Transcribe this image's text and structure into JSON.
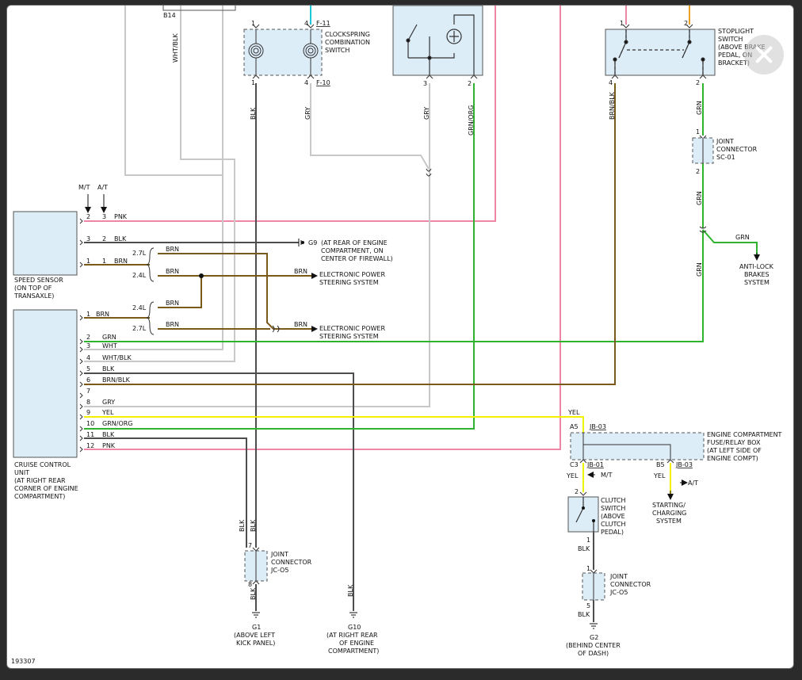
{
  "diagram_id": "193307",
  "colors": {
    "pink": "#ee86a6",
    "black": "#4d4d4d",
    "white": "#c8c8c8",
    "green": "#2fb32f",
    "brown": "#7a5a1a",
    "yellow": "#f2f200",
    "blue": "#1ec8d8",
    "orange": "#f0a020",
    "box_fill": "#dcedf8"
  },
  "components": {
    "b14": "B14",
    "clockspring": {
      "name": [
        "CLOCKSPRING",
        "COMBINATION",
        "SWITCH"
      ],
      "pin_tl": "1",
      "pin_tr": "4",
      "pin_bl": "1",
      "pin_br": "4",
      "conn_top": "F-11",
      "conn_bottom": "F-10"
    },
    "center_switch": {
      "pin_left": "3",
      "pin_right": "2"
    },
    "stoplight": {
      "name": [
        "STOPLIGHT",
        "SWITCH",
        "(ABOVE BRAKE",
        "PEDAL, ON",
        "BRACKET)"
      ],
      "pin_tl": "1",
      "pin_tr": "2",
      "pin_bl": "4",
      "pin_br": "2"
    },
    "joint_sc01": {
      "name": [
        "JOINT",
        "CONNECTOR",
        "SC-01"
      ],
      "pin_top": "1",
      "pin_bottom": "2"
    },
    "speed_sensor": {
      "name": [
        "SPEED SENSOR",
        "(ON TOP OF",
        "TRANSAXLE)"
      ]
    },
    "cruise_unit": {
      "name": [
        "CRUISE CONTROL",
        "UNIT",
        "(AT RIGHT REAR",
        "CORNER OF ENGINE",
        "COMPARTMENT)"
      ]
    },
    "engine_box": {
      "name": [
        "ENGINE COMPARTMENT",
        "FUSE/RELAY BOX",
        "(AT LEFT SIDE OF",
        "ENGINE COMPT)"
      ],
      "a5": "A5",
      "c3": "C3",
      "b5": "B5",
      "jb": "JB-03",
      "jb01": "JB-01",
      "jb03b": "JB-03"
    },
    "clutch": {
      "name": [
        "CLUTCH",
        "SWITCH",
        "(ABOVE",
        "CLUTCH",
        "PEDAL)"
      ],
      "pin_top": "2",
      "pin_bottom": "1"
    },
    "joint_jc05_left": {
      "name": [
        "JOINT",
        "CONNECTOR",
        "JC-O5"
      ],
      "pin_top": "7",
      "pin_bottom": "8"
    },
    "joint_jc05_right": {
      "name": [
        "JOINT",
        "CONNECTOR",
        "JC-O5"
      ],
      "pin_top": "1",
      "pin_bottom": "5"
    },
    "g1": {
      "name": [
        "G1",
        "(ABOVE LEFT",
        "KICK PANEL)"
      ]
    },
    "g10": {
      "name": [
        "G10",
        "(AT RIGHT REAR",
        "OF ENGINE",
        "COMPARTMENT)"
      ]
    },
    "g2": {
      "name": [
        "G2",
        "(BEHIND CENTER",
        "OF DASH)"
      ]
    },
    "g9": {
      "label": "G9",
      "name": [
        "(AT REAR OF ENGINE",
        "COMPARTMENT, ON",
        "CENTER OF FIREWALL)"
      ]
    },
    "eps1": [
      "ELECTRONIC POWER",
      "STEERING SYSTEM"
    ],
    "eps2": [
      "ELECTRONIC POWER",
      "STEERING SYSTEM"
    ],
    "abs": [
      "ANTI-LOCK",
      "BRAKES",
      "SYSTEM"
    ],
    "starting": [
      "STARTING/",
      "CHARGING",
      "SYSTEM"
    ]
  },
  "speed_sensor_header": {
    "mt": "M/T",
    "at": "A/T"
  },
  "speed_sensor_pins": [
    {
      "mt": "2",
      "at": "3",
      "wire": "PNK"
    },
    {
      "mt": "3",
      "at": "2",
      "wire": "BLK"
    },
    {
      "mt": "1",
      "at": "1",
      "wire": "BRN"
    }
  ],
  "cruise_pins": [
    {
      "pin": "1",
      "wire": "BRN"
    },
    {
      "pin": "2",
      "wire": "GRN"
    },
    {
      "pin": "3",
      "wire": "WHT"
    },
    {
      "pin": "4",
      "wire": "WHT/BLK"
    },
    {
      "pin": "5",
      "wire": "BLK"
    },
    {
      "pin": "6",
      "wire": "BRN/BLK"
    },
    {
      "pin": "7",
      "wire": ""
    },
    {
      "pin": "8",
      "wire": "GRY"
    },
    {
      "pin": "9",
      "wire": "YEL"
    },
    {
      "pin": "10",
      "wire": "GRN/ORG"
    },
    {
      "pin": "11",
      "wire": "BLK"
    },
    {
      "pin": "12",
      "wire": "PNK"
    }
  ],
  "wire_labels": {
    "wht_blk_v": "WHT/BLK",
    "blk_cs": "BLK",
    "gry_cs": "GRY",
    "gry_center": "GRY",
    "grn_org_v": "GRN/ORG",
    "brn_blk_v": "BRN/BLK",
    "grn_1": "GRN",
    "grn_2": "GRN",
    "grn_3": "GRN",
    "grn_h": "GRN",
    "brn_27a": "2.7L",
    "brn_24a": "2.4L",
    "brn_a1": "BRN",
    "brn_a2": "BRN",
    "brn_24b": "2.4L",
    "brn_27b": "2.7L",
    "brn_b1": "BRN",
    "brn_b2": "BRN",
    "brn_eps1": "BRN",
    "brn_eps2": "BRN",
    "yel_top": "YEL",
    "yel_c3": "YEL",
    "mt": "M/T",
    "yel_b5": "YEL",
    "at": "A/T",
    "blk_jl1": "BLK",
    "blk_jl2": "BLK",
    "blk_jl3": "BLK",
    "blk_g10": "BLK",
    "blk_clutch": "BLK",
    "blk_jr": "BLK"
  }
}
